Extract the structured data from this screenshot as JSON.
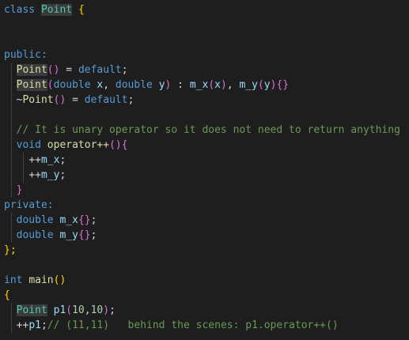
{
  "editor": {
    "background": "#1e1e1e",
    "colors": {
      "kw": "#569cd6",
      "type": "#4ec9b0",
      "fn": "#dcdcaa",
      "var": "#9cdcfe",
      "num": "#b5cea8",
      "comment": "#6a9955",
      "plain": "#d4d4d4",
      "brace1": "#ffd700",
      "brace2": "#da70d6",
      "brace3": "#179fff"
    },
    "lines": [
      [
        [
          "class",
          "kw"
        ],
        [
          " ",
          "plain"
        ],
        [
          "Point",
          "type",
          "hl"
        ],
        [
          " ",
          "plain"
        ],
        [
          "{",
          "brace1"
        ]
      ],
      [],
      [],
      [
        [
          "public:",
          "kw"
        ]
      ],
      [
        [
          "  ",
          "plain"
        ],
        [
          "Point",
          "fn",
          "hl"
        ],
        [
          "()",
          "brace2"
        ],
        [
          " = ",
          "plain"
        ],
        [
          "default",
          "kw"
        ],
        [
          ";",
          "plain"
        ]
      ],
      [
        [
          "  ",
          "plain"
        ],
        [
          "Point",
          "fn",
          "hl"
        ],
        [
          "(",
          "brace2"
        ],
        [
          "double",
          "kw"
        ],
        [
          " ",
          "plain"
        ],
        [
          "x",
          "var"
        ],
        [
          ", ",
          "plain"
        ],
        [
          "double",
          "kw"
        ],
        [
          " ",
          "plain"
        ],
        [
          "y",
          "var"
        ],
        [
          ")",
          "brace2"
        ],
        [
          " : ",
          "plain"
        ],
        [
          "m_x",
          "var"
        ],
        [
          "(",
          "brace2"
        ],
        [
          "x",
          "var"
        ],
        [
          ")",
          "brace2"
        ],
        [
          ", ",
          "plain"
        ],
        [
          "m_y",
          "var"
        ],
        [
          "(",
          "brace2"
        ],
        [
          "y",
          "var"
        ],
        [
          ")",
          "brace2"
        ],
        [
          "{}",
          "brace2"
        ]
      ],
      [
        [
          "  ~",
          "plain"
        ],
        [
          "Point",
          "fn"
        ],
        [
          "()",
          "brace2"
        ],
        [
          " = ",
          "plain"
        ],
        [
          "default",
          "kw"
        ],
        [
          ";",
          "plain"
        ]
      ],
      [],
      [
        [
          "  ",
          "plain"
        ],
        [
          "// It is unary operator so it does not need to return anything",
          "comment"
        ]
      ],
      [
        [
          "  ",
          "plain"
        ],
        [
          "void",
          "kw"
        ],
        [
          " ",
          "plain"
        ],
        [
          "operator++",
          "fn"
        ],
        [
          "()",
          "brace2"
        ],
        [
          "{",
          "brace2"
        ]
      ],
      [
        [
          "    ",
          "plain"
        ],
        [
          "++",
          "plain"
        ],
        [
          "m_x",
          "var"
        ],
        [
          ";",
          "plain"
        ]
      ],
      [
        [
          "    ",
          "plain"
        ],
        [
          "++",
          "plain"
        ],
        [
          "m_y",
          "var"
        ],
        [
          ";",
          "plain"
        ]
      ],
      [
        [
          "  ",
          "plain"
        ],
        [
          "}",
          "brace2"
        ]
      ],
      [
        [
          "private:",
          "kw"
        ]
      ],
      [
        [
          "  ",
          "plain"
        ],
        [
          "double",
          "kw"
        ],
        [
          " ",
          "plain"
        ],
        [
          "m_x",
          "var"
        ],
        [
          "{}",
          "brace2"
        ],
        [
          ";",
          "plain"
        ]
      ],
      [
        [
          "  ",
          "plain"
        ],
        [
          "double",
          "kw"
        ],
        [
          " ",
          "plain"
        ],
        [
          "m_y",
          "var"
        ],
        [
          "{}",
          "brace2"
        ],
        [
          ";",
          "plain"
        ]
      ],
      [
        [
          "};",
          "brace1"
        ]
      ],
      [],
      [
        [
          "int",
          "kw"
        ],
        [
          " ",
          "plain"
        ],
        [
          "main",
          "fn"
        ],
        [
          "()",
          "brace1"
        ]
      ],
      [
        [
          "{",
          "brace1"
        ]
      ],
      [
        [
          "  ",
          "plain"
        ],
        [
          "Point",
          "type",
          "hl"
        ],
        [
          " ",
          "plain"
        ],
        [
          "p1",
          "var"
        ],
        [
          "(",
          "brace2"
        ],
        [
          "10",
          "num"
        ],
        [
          ",",
          "plain"
        ],
        [
          "10",
          "num"
        ],
        [
          ")",
          "brace2"
        ],
        [
          ";",
          "plain"
        ]
      ],
      [
        [
          "  ",
          "plain"
        ],
        [
          "++",
          "plain"
        ],
        [
          "p1",
          "var"
        ],
        [
          ";",
          "plain"
        ],
        [
          "// (11,11)   behind the scenes: p1.operator++()",
          "comment"
        ]
      ]
    ]
  }
}
